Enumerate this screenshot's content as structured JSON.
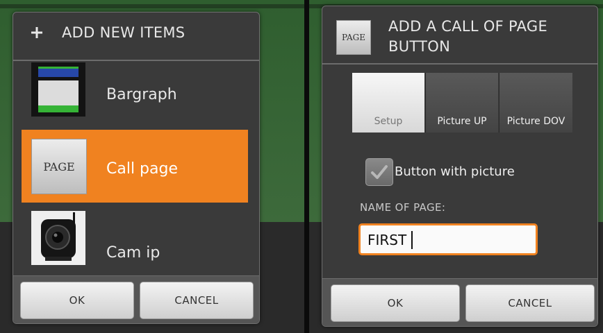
{
  "left": {
    "title": "ADD NEW ITEMS",
    "items": [
      {
        "label": "Bargraph",
        "icon": "bargraph-icon",
        "selected": false
      },
      {
        "label": "Call page",
        "icon": "page-icon",
        "thumb_text": "PAGE",
        "selected": true
      },
      {
        "label": "Cam ip",
        "icon": "camera-icon",
        "selected": false
      }
    ],
    "ok_label": "OK",
    "cancel_label": "CANCEL"
  },
  "right": {
    "icon_text": "PAGE",
    "title_line1": "ADD A CALL OF PAGE",
    "title_line2": "BUTTON",
    "tabs": [
      {
        "label": "Setup",
        "active": true
      },
      {
        "label": "Picture UP",
        "active": false
      },
      {
        "label": "Picture DOV",
        "active": false
      }
    ],
    "checkbox_label": "Button with picture",
    "checkbox_checked": true,
    "field_label": "NAME OF PAGE:",
    "field_value": "FIRST",
    "ok_label": "OK",
    "cancel_label": "CANCEL"
  },
  "colors": {
    "selection": "#f08220",
    "dialog_bg": "#3a3a3a",
    "field_border": "#f08220"
  }
}
